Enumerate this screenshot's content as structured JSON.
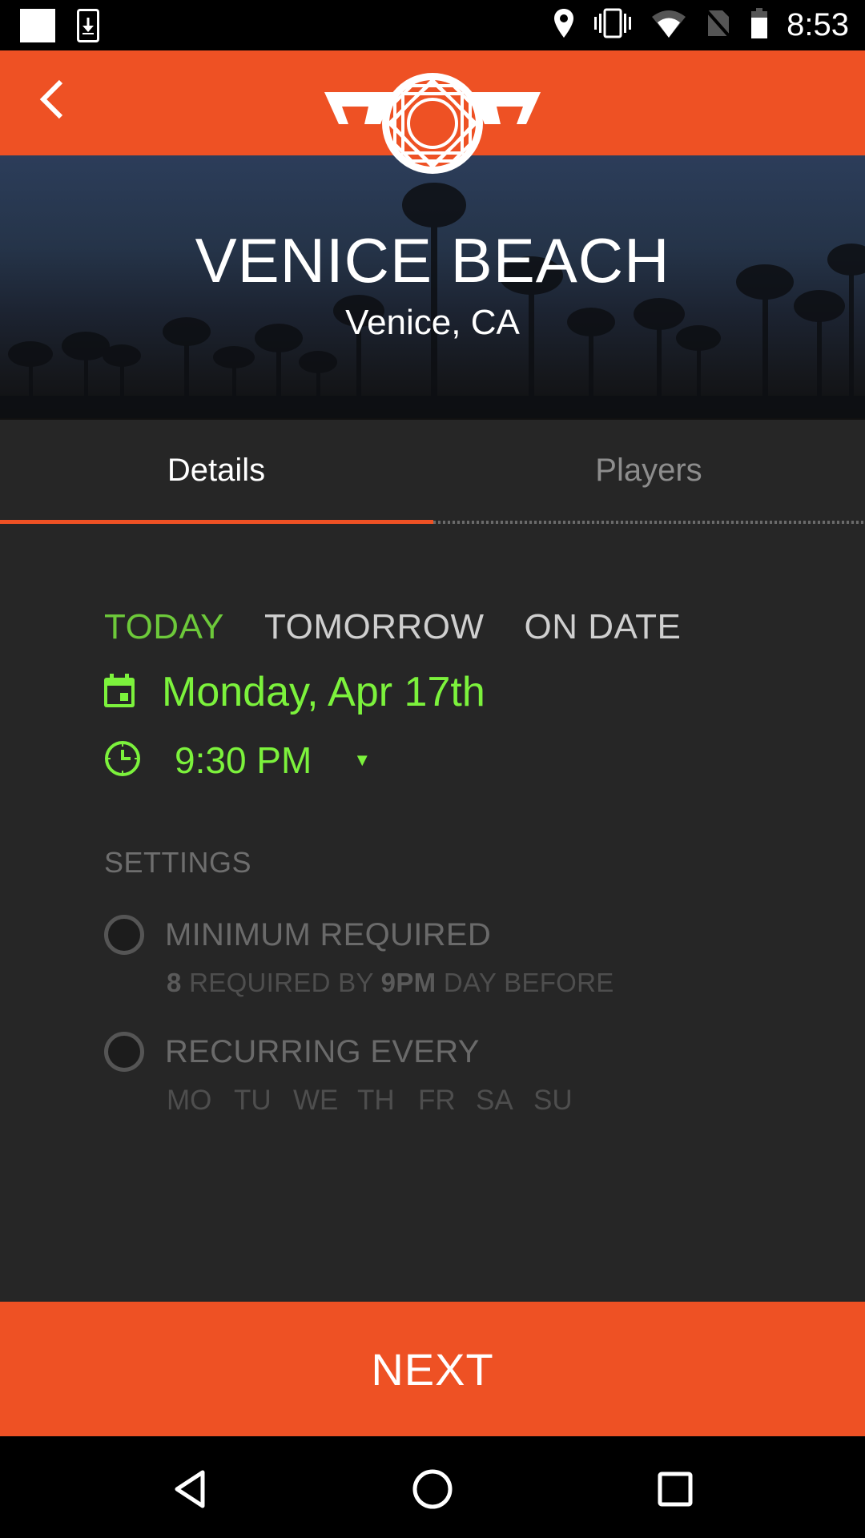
{
  "status_bar": {
    "time": "8:53",
    "left_icons": [
      "notification-square-icon",
      "download-icon"
    ],
    "right_icons": [
      "location-icon",
      "vibrate-icon",
      "wifi-icon",
      "no-sim-icon",
      "battery-icon"
    ]
  },
  "app_bar": {
    "back_icon": "chevron-left-icon",
    "logo": "basketball-hoop-logo"
  },
  "hero": {
    "title": "VENICE BEACH",
    "subtitle": "Venice, CA"
  },
  "tabs": [
    {
      "label": "Details",
      "active": true
    },
    {
      "label": "Players",
      "active": false
    }
  ],
  "schedule": {
    "day_options": [
      {
        "label": "TODAY",
        "active": true
      },
      {
        "label": "TOMORROW",
        "active": false
      },
      {
        "label": "ON DATE",
        "active": false
      }
    ],
    "date_label": "Monday, Apr 17th",
    "time_label": "9:30 PM",
    "time_caret": "▼"
  },
  "settings": {
    "title": "SETTINGS",
    "minimum_required": {
      "label": "MINIMUM REQUIRED",
      "checked": false,
      "count": "8",
      "text_mid": " REQUIRED BY ",
      "deadline": "9PM",
      "text_end": " DAY BEFORE"
    },
    "recurring": {
      "label": "RECURRING EVERY",
      "checked": false,
      "days": [
        "MO",
        "TU",
        "WE",
        "TH",
        "FR",
        "SA",
        "SU"
      ]
    }
  },
  "next_button": {
    "label": "NEXT"
  },
  "nav_bar": {
    "icons": [
      "back-triangle-icon",
      "home-circle-icon",
      "recents-square-icon"
    ]
  },
  "colors": {
    "brand_orange": "#ee5124",
    "accent_green": "#7cf23c",
    "active_day_green": "#6dc93a",
    "background": "#262626"
  }
}
